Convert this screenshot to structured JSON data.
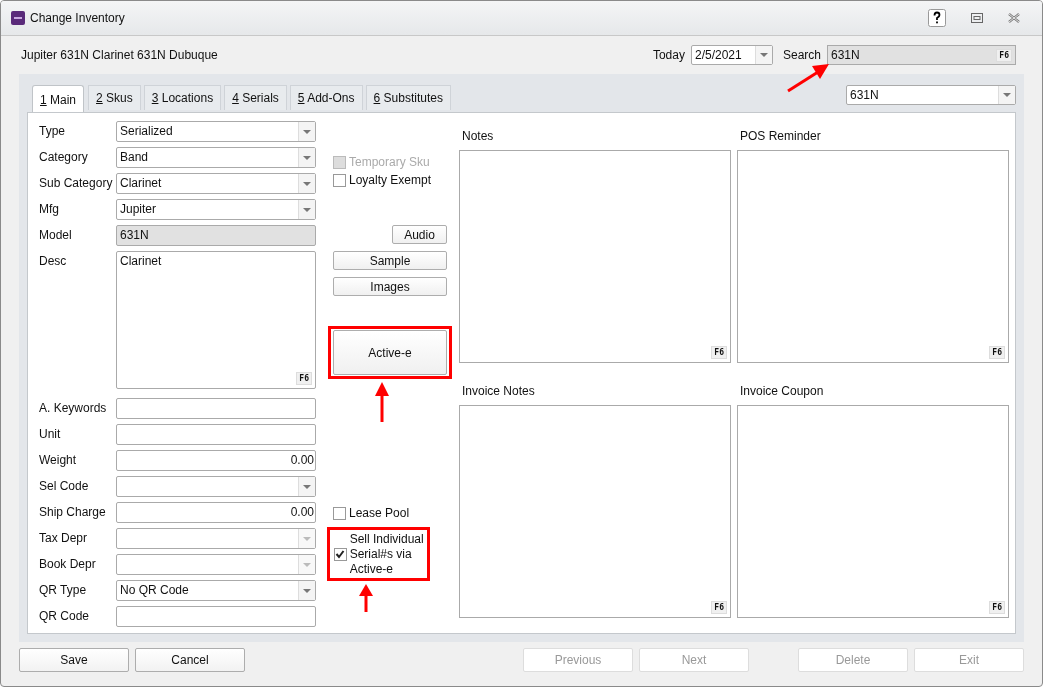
{
  "window": {
    "title": "Change Inventory"
  },
  "header": {
    "item_title": "Jupiter 631N Clarinet 631N Dubuque",
    "today_label": "Today",
    "today_value": "2/5/2021",
    "search_label": "Search",
    "search_value": "631N",
    "search_key": "F6"
  },
  "tabs": [
    {
      "key": "1",
      "label": "Main",
      "selected": true
    },
    {
      "key": "2",
      "label": "Skus",
      "selected": false
    },
    {
      "key": "3",
      "label": "Locations",
      "selected": false
    },
    {
      "key": "4",
      "label": "Serials",
      "selected": false
    },
    {
      "key": "5",
      "label": "Add-Ons",
      "selected": false
    },
    {
      "key": "6",
      "label": "Substitutes",
      "selected": false
    }
  ],
  "lookup": {
    "value": "631N"
  },
  "fields": [
    {
      "label": "Type",
      "kind": "combo",
      "value": "Serialized",
      "disabled": false
    },
    {
      "label": "Category",
      "kind": "combo",
      "value": "Band",
      "disabled": false
    },
    {
      "label": "Sub Category",
      "kind": "combo",
      "value": "Clarinet",
      "disabled": false
    },
    {
      "label": "Mfg",
      "kind": "combo",
      "value": "Jupiter",
      "disabled": false
    },
    {
      "label": "Model",
      "kind": "readonly",
      "value": "631N"
    },
    {
      "label": "Desc",
      "kind": "memo",
      "value": "Clarinet",
      "key": "F6"
    },
    {
      "label": "A. Keywords",
      "kind": "text"
    },
    {
      "label": "Unit",
      "kind": "text"
    },
    {
      "label": "Weight",
      "kind": "number",
      "value": "0.00"
    },
    {
      "label": "Sel Code",
      "kind": "combo",
      "disabled": false
    },
    {
      "label": "Ship Charge",
      "kind": "number",
      "value": "0.00"
    },
    {
      "label": "Tax Depr",
      "kind": "combo",
      "disabled": true
    },
    {
      "label": "Book Depr",
      "kind": "combo",
      "disabled": true
    },
    {
      "label": "QR Type",
      "kind": "combo",
      "value": "No QR Code",
      "disabled": false
    },
    {
      "label": "QR Code",
      "kind": "text"
    }
  ],
  "flags_top": [
    {
      "label": "Temporary Sku",
      "checked": false,
      "disabled": true
    },
    {
      "label": "Loyalty Exempt",
      "checked": false,
      "disabled": false
    }
  ],
  "media_buttons": [
    {
      "label": "Audio"
    },
    {
      "label": "Sample"
    },
    {
      "label": "Images"
    }
  ],
  "active_e_button": {
    "label": "Active-e"
  },
  "flags_bottom": [
    {
      "label": "Lease Pool",
      "checked": false,
      "disabled": false
    },
    {
      "label": "Sell Individual Serial#s via Active-e",
      "checked": true,
      "disabled": false
    }
  ],
  "memos": [
    {
      "label": "Notes",
      "key": "F6"
    },
    {
      "label": "POS Reminder",
      "key": "F6"
    },
    {
      "label": "Invoice Notes",
      "key": "F6"
    },
    {
      "label": "Invoice Coupon",
      "key": "F6"
    }
  ],
  "footer_buttons": [
    {
      "label": "Save",
      "disabled": false
    },
    {
      "label": "Cancel",
      "disabled": false
    },
    {
      "label": "Previous",
      "disabled": true
    },
    {
      "label": "Next",
      "disabled": true
    },
    {
      "label": "Delete",
      "disabled": true
    },
    {
      "label": "Exit",
      "disabled": true
    }
  ]
}
